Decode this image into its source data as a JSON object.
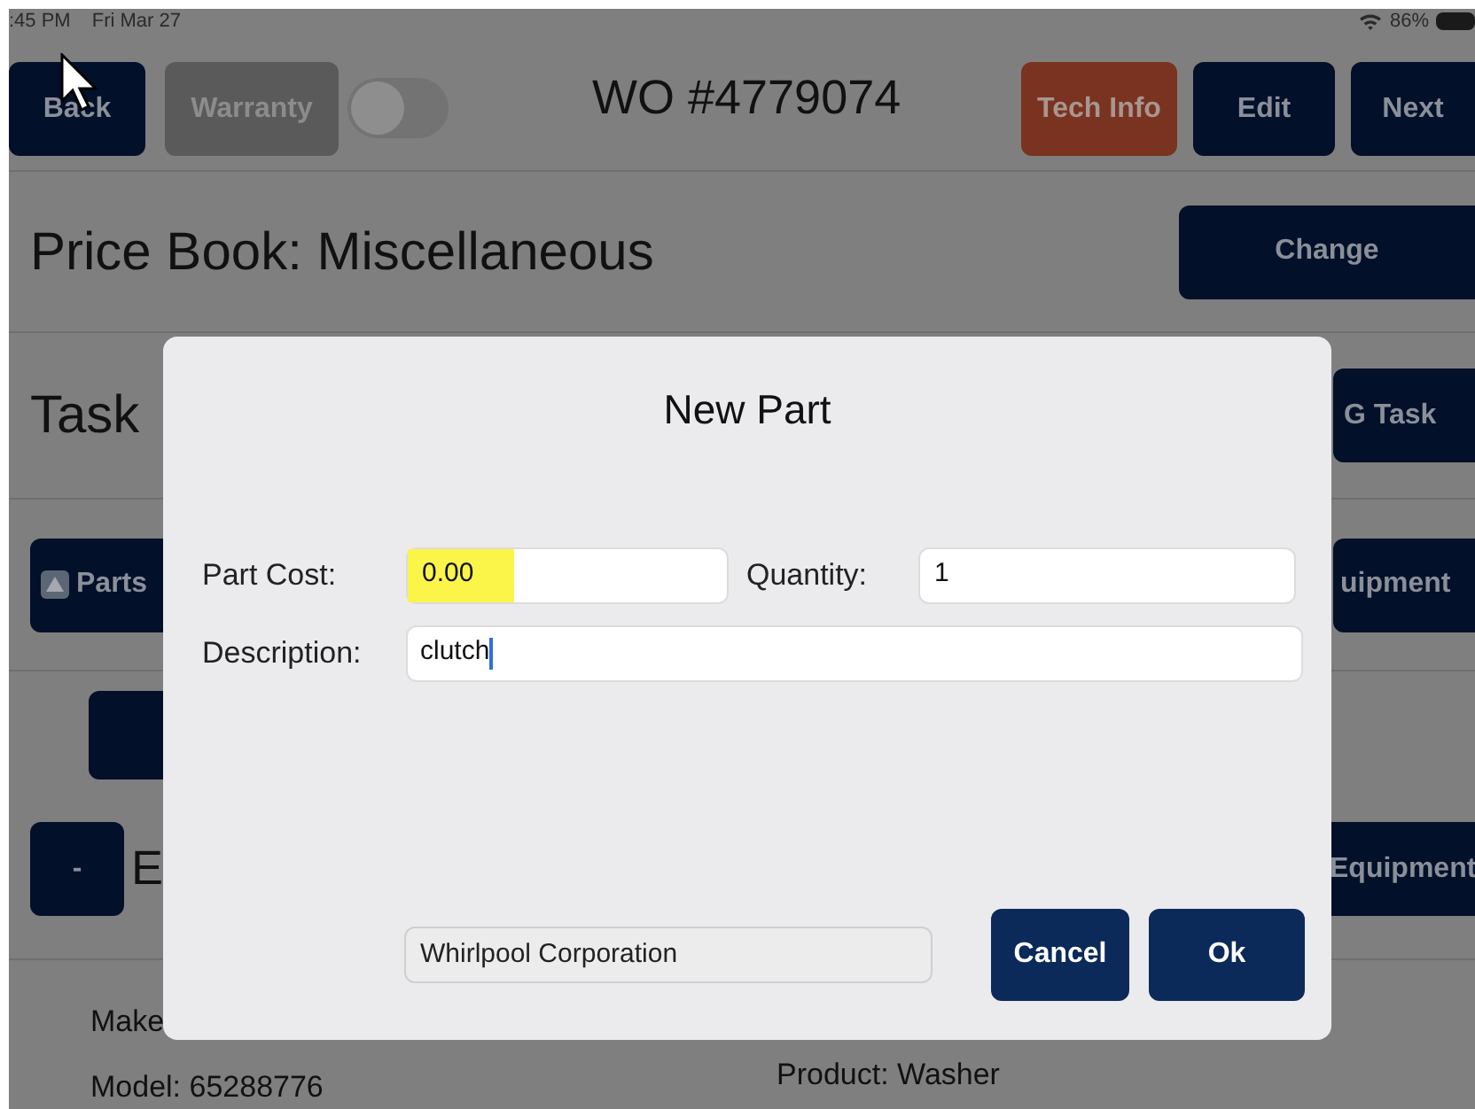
{
  "status_bar": {
    "time": ":45 PM",
    "date": "Fri Mar 27",
    "battery": "86%"
  },
  "toolbar": {
    "back": "Back",
    "warranty": "Warranty",
    "warranty_on": false,
    "title": "WO #4779074",
    "tech_info": "Tech Info",
    "edit": "Edit",
    "next": "Next"
  },
  "price_book": {
    "title": "Price Book: Miscellaneous",
    "button": "Change"
  },
  "tasks": {
    "title": "Task",
    "button": "G Task"
  },
  "parts_row": {
    "parts": "Parts",
    "equipment": "uipment"
  },
  "equipment_row": {
    "collapse": "-",
    "title": "E",
    "button": "Equipment"
  },
  "details": [
    {
      "label": "Make"
    },
    {
      "label": "Model: 65288776"
    }
  ],
  "details_right": [
    {
      "label": "Product: Washer"
    }
  ],
  "dialog": {
    "title": "New Part",
    "fields": [
      {
        "label": "Part Cost:",
        "value": "0.00",
        "highlighted": true
      },
      {
        "label": "Quantity:",
        "value": "1",
        "highlighted": false
      }
    ],
    "description": {
      "label": "Description:",
      "value": "clutch"
    },
    "manufacturer": "Whirlpool Corporation",
    "buttons": [
      {
        "label": "Cancel"
      },
      {
        "label": "Ok"
      }
    ]
  }
}
